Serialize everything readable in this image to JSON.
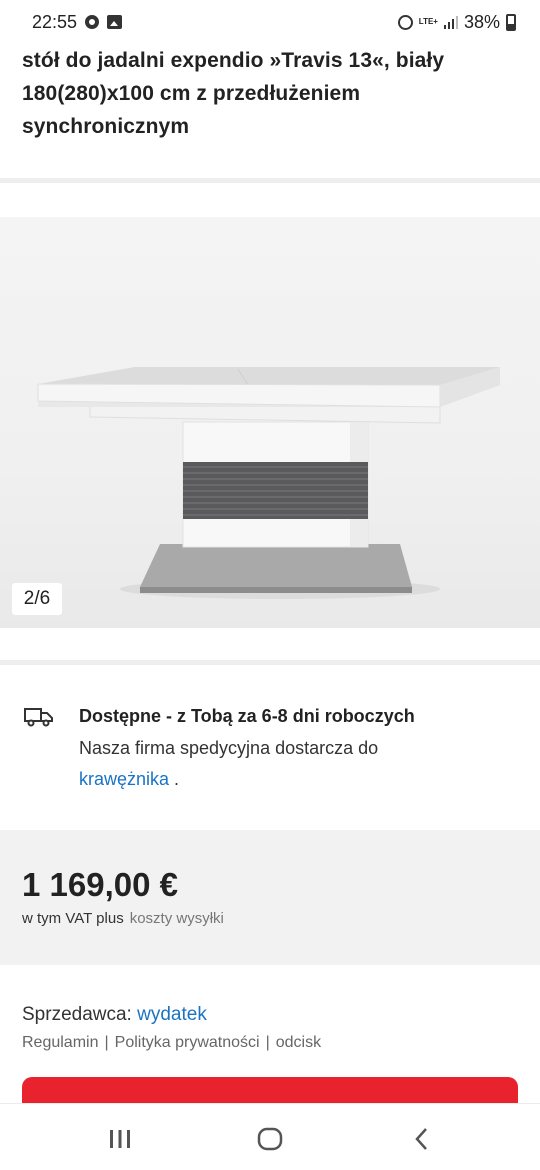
{
  "status_bar": {
    "time": "22:55",
    "network": "LTE+",
    "battery": "38%"
  },
  "product": {
    "title_line1": "stół do jadalni expendio »Travis 13«, biały",
    "title_line2": "180(280)x100 cm z przedłużeniem",
    "title_line3": "synchronicznym"
  },
  "gallery": {
    "counter": "2/6"
  },
  "delivery": {
    "icon": "truck-icon",
    "title": "Dostępne - z Tobą za 6-8 dni roboczych",
    "text": "Nasza firma spedycyjna dostarcza do",
    "link": "krawężnika",
    "suffix": " ."
  },
  "pricing": {
    "price": "1 169,00 €",
    "vat_label": "w tym VAT plus",
    "shipping_link": "koszty wysyłki"
  },
  "seller": {
    "label": "Sprzedawca: ",
    "name": "wydatek",
    "links": [
      "Regulamin",
      "Polityka prywatności",
      "odcisk"
    ]
  },
  "colors": {
    "accent": "#e8232e",
    "link": "#1a73c5"
  },
  "nav": {
    "recent": "recent-apps-icon",
    "home": "home-icon",
    "back": "back-icon"
  }
}
